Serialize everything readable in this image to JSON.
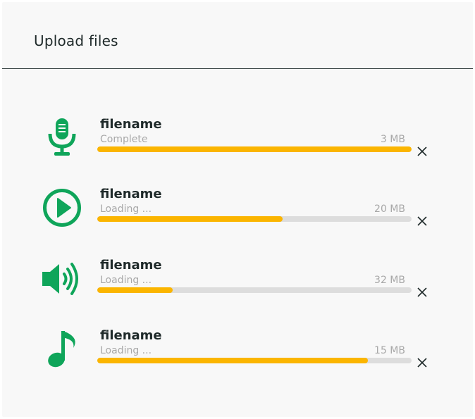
{
  "header": {
    "title": "Upload files"
  },
  "accent_color": "#0fa55a",
  "progress_color": "#fbb500",
  "files": [
    {
      "name": "filename",
      "status": "Complete",
      "size": "3 MB",
      "progress": 1.0,
      "icon": "microphone-icon"
    },
    {
      "name": "filename",
      "status": "Loading ...",
      "size": "20 MB",
      "progress": 0.59,
      "icon": "play-circle-icon"
    },
    {
      "name": "filename",
      "status": "Loading ...",
      "size": "32 MB",
      "progress": 0.24,
      "icon": "speaker-icon"
    },
    {
      "name": "filename",
      "status": "Loading ...",
      "size": "15 MB",
      "progress": 0.86,
      "icon": "music-note-icon"
    }
  ]
}
